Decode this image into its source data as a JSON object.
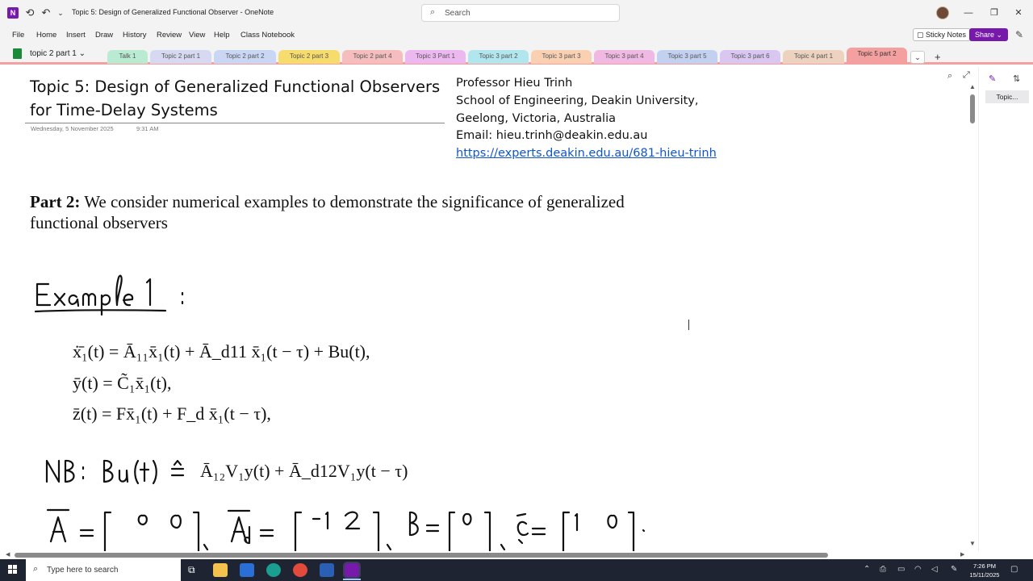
{
  "window": {
    "app_icon": "onenote-logo",
    "title": "Topic 5: Design of Generalized Functional Observer  -  OneNote",
    "search_placeholder": "Search",
    "controls": [
      "minimize-icon",
      "restore-icon",
      "close-icon"
    ]
  },
  "menu": {
    "items": [
      "File",
      "Home",
      "Insert",
      "Draw",
      "History",
      "Review",
      "View",
      "Help",
      "Class Notebook"
    ],
    "sticky_notes": "Sticky Notes",
    "share": "Share"
  },
  "notebook": {
    "name": "topic 2 part 1",
    "tabs": [
      {
        "label": "Talk 1",
        "color": "#b9ead2"
      },
      {
        "label": "Topic 2  part 1",
        "color": "#d7d9f2"
      },
      {
        "label": "Topic 2  part 2",
        "color": "#c9d6f4"
      },
      {
        "label": "Topic 2 part 3",
        "color": "#f6dc6c"
      },
      {
        "label": "Topic 2 part 4",
        "color": "#f5bdbd"
      },
      {
        "label": "Topic 3 Part 1",
        "color": "#ebb8ef"
      },
      {
        "label": "Topic 3 part 2",
        "color": "#b2e6ee"
      },
      {
        "label": "Topic 3 part 3",
        "color": "#f9d1b2"
      },
      {
        "label": "Topic 3 part 4",
        "color": "#f0b9e4"
      },
      {
        "label": "Topic 3 part 5",
        "color": "#c3d1f1"
      },
      {
        "label": "Topic 3 part 6",
        "color": "#d9c7f2"
      },
      {
        "label": "Topic 4  part 1",
        "color": "#ecd2bf"
      },
      {
        "label": "Topic 5 part 2",
        "color": "#f4a0a0",
        "active": true
      }
    ]
  },
  "page": {
    "title": "Topic 5: Design of Generalized Functional Observers for Time-Delay Systems",
    "date": "Wednesday, 5 November 2025",
    "time": "9:31 AM",
    "author_lines": [
      "Professor Hieu Trinh",
      "School of Engineering, Deakin University,",
      "Geelong, Victoria, Australia",
      "Email: hieu.trinh@deakin.edu.au"
    ],
    "link": "https://experts.deakin.edu.au/681-hieu-trinh",
    "part2_bold": "Part 2:",
    "part2_text": " We consider numerical examples to demonstrate the significance of generalized functional observers",
    "handwriting_example": "Example 1 :",
    "nb_prefix": "NB:",
    "nb_handwritten_lhs": "Bu(t) ≙",
    "equations": [
      "ẋ̄₁(t) = Ā₁₁x̄₁(t) + Ā_d11 x̄₁(t − τ) + Bu(t),",
      "ȳ(t) = C̃₁x̄₁(t),",
      "z̄(t) = Fx̄₁(t) + F_d x̄₁(t − τ),"
    ],
    "nb_rhs": "Ā₁₂V₁y(t) + Ā_d12V₁y(t − τ)"
  },
  "right_pane": {
    "page_label": "Topic..."
  },
  "taskbar": {
    "search_placeholder": "Type here to search",
    "time": "7:26 PM",
    "date": "15/11/2025"
  }
}
